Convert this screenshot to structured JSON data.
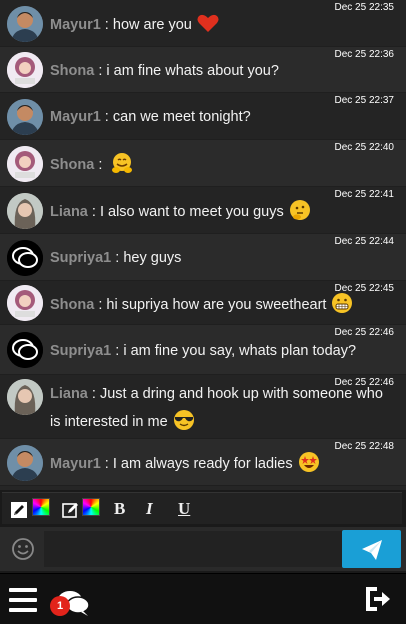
{
  "messages": [
    {
      "user": "Mayur1",
      "avatar": "mayur",
      "text": "how are you",
      "emoji": "heart",
      "time": "Dec 25 22:35"
    },
    {
      "user": "Shona",
      "avatar": "shona",
      "text": "i am fine whats about you?",
      "emoji": "",
      "time": "Dec 25 22:36"
    },
    {
      "user": "Mayur1",
      "avatar": "mayur",
      "text": "can we meet tonight?",
      "emoji": "",
      "time": "Dec 25 22:37"
    },
    {
      "user": "Shona",
      "avatar": "shona",
      "text": "",
      "emoji": "hug-face",
      "time": "Dec 25 22:40"
    },
    {
      "user": "Liana",
      "avatar": "liana",
      "text": "I also want to meet you guys",
      "emoji": "thinking-face",
      "time": "Dec 25 22:41"
    },
    {
      "user": "Supriya1",
      "avatar": "supriya",
      "text": "hey guys",
      "emoji": "",
      "time": "Dec 25 22:44"
    },
    {
      "user": "Shona",
      "avatar": "shona",
      "text": "hi supriya how are you sweetheart",
      "emoji": "grimace-face",
      "time": "Dec 25 22:45"
    },
    {
      "user": "Supriya1",
      "avatar": "supriya",
      "text": "i am fine you say, whats plan today?",
      "emoji": "",
      "time": "Dec 25 22:46"
    },
    {
      "user": "Liana",
      "avatar": "liana",
      "text": "Just a dring and hook up with someone who is interested in me",
      "emoji": "sunglasses-face",
      "time": "Dec 25 22:46"
    },
    {
      "user": "Mayur1",
      "avatar": "mayur",
      "text": "I am always ready for ladies",
      "emoji": "star-eyes-face",
      "time": "Dec 25 22:48"
    }
  ],
  "separator": " : ",
  "toolbar": {
    "bold": "B",
    "italic": "I",
    "underline": "U",
    "icons": [
      "text-color-pencil-icon",
      "color-picker-icon",
      "bg-color-edit-icon",
      "color-picker-icon"
    ]
  },
  "input": {
    "placeholder": "",
    "value": ""
  },
  "footer": {
    "notification_count": "1"
  },
  "colors": {
    "send": "#1a9fd6",
    "badge": "#e2241b",
    "username": "#8e8e8e"
  }
}
